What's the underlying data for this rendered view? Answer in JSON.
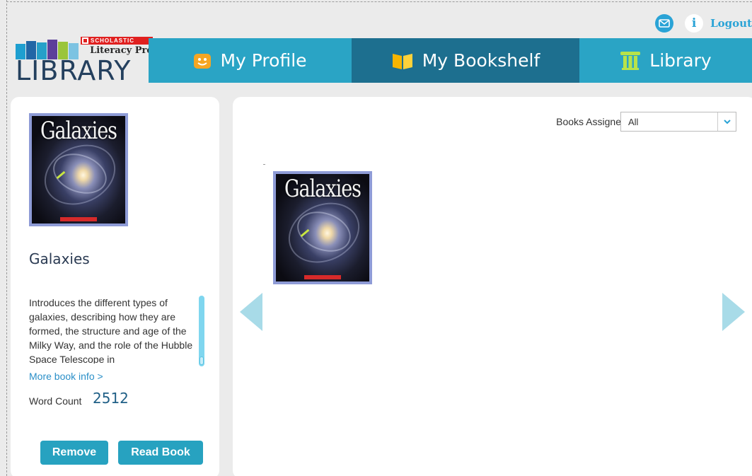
{
  "utility": {
    "logout_label": "Logout",
    "info_glyph": "i"
  },
  "logo": {
    "badge": "SCHOLASTIC",
    "subtitle": "Literacy Pro",
    "title": "LIBRARY"
  },
  "nav": {
    "tabs": [
      {
        "label": "My Profile",
        "icon": "smiley-face-icon",
        "active": false
      },
      {
        "label": "My Bookshelf",
        "icon": "open-book-icon",
        "active": true
      },
      {
        "label": "Library",
        "icon": "pillar-icon",
        "active": false
      }
    ]
  },
  "selected_book": {
    "cover_title": "Galaxies",
    "title": "Galaxies",
    "description": "Introduces the different types of galaxies, describing how they are formed, the structure and age of the Milky Way, and the role of the Hubble Space Telescope in",
    "more_info_label": "More book info >",
    "word_count_label": "Word Count",
    "word_count": "2512",
    "remove_label": "Remove",
    "read_label": "Read Book"
  },
  "bookshelf": {
    "filter_label": "Books Assigned By",
    "filter_value": "All",
    "books": [
      {
        "cover_title": "Galaxies"
      }
    ]
  },
  "colors": {
    "primary_tab": "#2aa4c5",
    "active_tab": "#1d6f8f",
    "button": "#27a2c0",
    "arrow": "#a8dbe8"
  }
}
